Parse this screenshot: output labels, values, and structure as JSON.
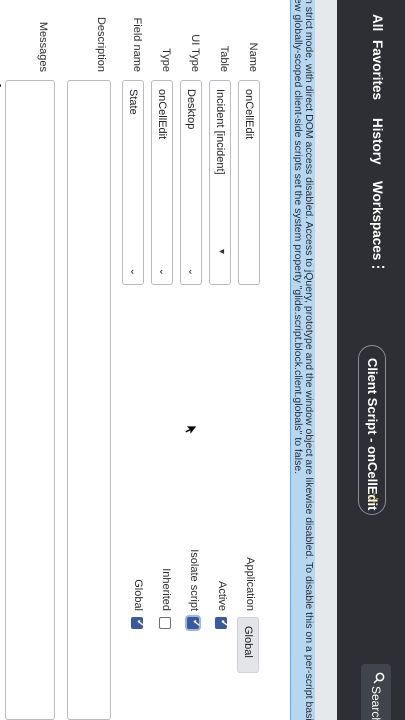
{
  "nav": {
    "items": [
      "All",
      "Favorites",
      "History",
      "Workspaces"
    ],
    "more": "⋮",
    "record_title": "Client Script - onCellEdit",
    "search_label": "Search"
  },
  "banner": {
    "line1": "n strict mode, with direct DOM access disabled. Access to jQuery, prototype and the window object are likewise disabled. To disable this on a per-script basis, c",
    "line2": "ew globally-scoped client-side scripts set the system property \"glide.script.block.client.globals\" to false."
  },
  "form": {
    "name": {
      "label": "Name",
      "value": "onCellEdit"
    },
    "table": {
      "label": "Table",
      "value": "Incident [incident]"
    },
    "ui_type": {
      "label": "UI Type",
      "value": "Desktop"
    },
    "type": {
      "label": "Type",
      "value": "onCellEdit"
    },
    "field_name": {
      "label": "Field name",
      "value": "State"
    },
    "description": {
      "label": "Description",
      "value": ""
    },
    "messages": {
      "label": "Messages",
      "value": ""
    }
  },
  "right": {
    "application": {
      "label": "Application",
      "value": "Global"
    },
    "active": {
      "label": "Active",
      "checked": true
    },
    "isolate_script": {
      "label": "Isolate script",
      "checked": true
    },
    "inherited": {
      "label": "Inherited",
      "checked": false
    },
    "global": {
      "label": "Global",
      "checked": true
    }
  },
  "colors": {
    "navbar": "#2d2f34",
    "banner": "#b6d7ef",
    "checkbox": "#3b5a9e"
  }
}
